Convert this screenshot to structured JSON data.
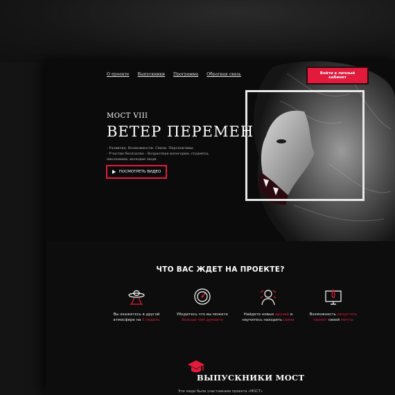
{
  "nav": {
    "items": [
      "О проекте",
      "Выпускники",
      "Программа",
      "Обратная связь"
    ],
    "cabinet_label": "Войти в личный кабинет"
  },
  "hero": {
    "kicker": "МОСТ VIII",
    "title": "ВЕТЕР ПЕРЕМЕН",
    "bullet1": "- Развитие. Возможности. Связи. Перспективы",
    "bullet2": "- Участие бесплатно - Возрастная категория: студенты, школьники, молодые люди",
    "video_label": "ПОСМОТРЕТЬ ВИДЕО"
  },
  "features": {
    "title": "ЧТО ВАС ЖДЕТ НА ПРОЕКТЕ?",
    "items": [
      {
        "icon": "ufo-icon",
        "pre": "Вы окажетесь в другой атмосфере на",
        "hl": "5 недель",
        "post": ""
      },
      {
        "icon": "speedometer-icon",
        "pre": "Убедитесь что вы можете",
        "hl": "больше чем думаете",
        "post": ""
      },
      {
        "icon": "person-network-icon",
        "pre": "Найдете новых",
        "hl": "друзей",
        "post": "и научитесь находить",
        "hl2": "связи"
      },
      {
        "icon": "rocket-monitor-icon",
        "pre": "Возможность",
        "hl": "запустить проект",
        "post": "своей",
        "hl2": "мечты"
      }
    ]
  },
  "graduates": {
    "icon": "graduation-cap-icon",
    "title": "ВЫПУСКНИКИ МОСТ",
    "subtitle": "Эти люди были участниками проекта «МОСТ»"
  },
  "colors": {
    "accent": "#e21b3c",
    "background": "#0d0d0d"
  }
}
